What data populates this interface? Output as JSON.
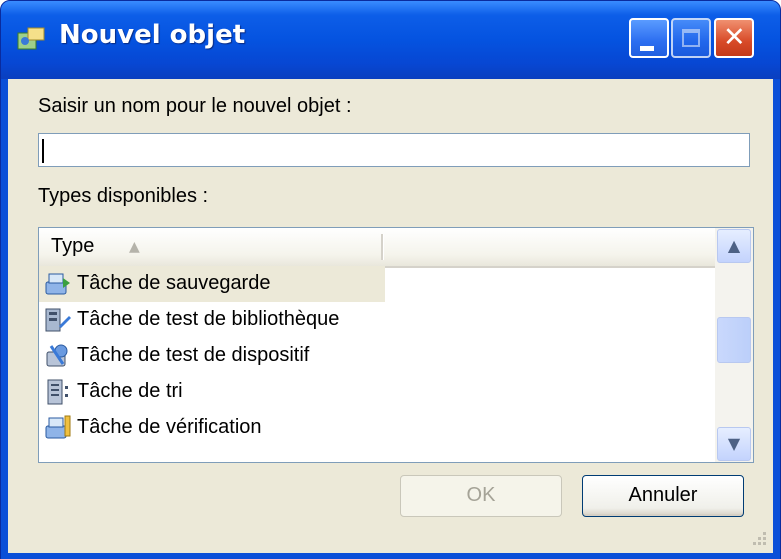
{
  "window": {
    "title": "Nouvel objet",
    "icon": "new-object-icon",
    "controls": [
      "minimize-icon",
      "maximize-icon",
      "close-icon"
    ],
    "accent_color": "#0a4fd8",
    "close_color": "#d84a28"
  },
  "form": {
    "name_label": "Saisir un nom pour le nouvel objet :",
    "name_value": "",
    "types_label": "Types disponibles :"
  },
  "list": {
    "columns": [
      {
        "label": "Type",
        "sort": "ascending"
      }
    ],
    "items": [
      {
        "label": "Tâche de sauvegarde",
        "icon": "backup-task-icon",
        "selected": true
      },
      {
        "label": "Tâche de test de bibliothèque",
        "icon": "library-test-task-icon",
        "selected": false
      },
      {
        "label": "Tâche de test de dispositif",
        "icon": "device-test-task-icon",
        "selected": false
      },
      {
        "label": "Tâche de tri",
        "icon": "sort-task-icon",
        "selected": false
      },
      {
        "label": "Tâche de vérification",
        "icon": "verification-task-icon",
        "selected": false
      }
    ]
  },
  "buttons": {
    "ok_label": "OK",
    "ok_enabled": false,
    "cancel_label": "Annuler"
  }
}
